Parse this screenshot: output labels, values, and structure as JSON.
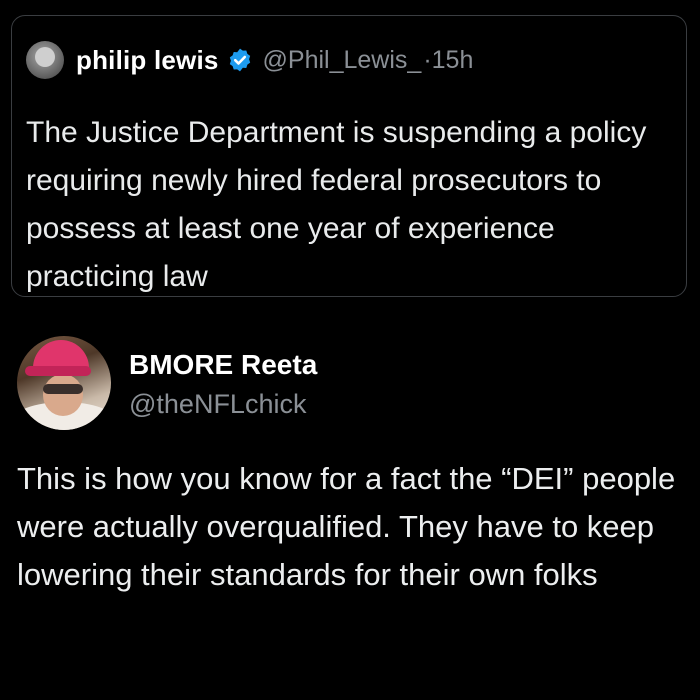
{
  "quoted_tweet": {
    "author_name": "philip lewis",
    "handle": "@Phil_Lewis_",
    "time": "·15h",
    "text": "The Justice Department is suspending a policy requiring newly hired federal prosecutors to possess at least one year of experience practicing law",
    "verified_icon": "verified-badge-icon",
    "verified_color": "#1d9bf0"
  },
  "reply_tweet": {
    "author_name": "BMORE Reeta",
    "handle": "@theNFLchick",
    "text": "This is how you know for a fact the “DEI” people were actually overqualified. They have to keep lowering their standards for their own folks"
  },
  "colors": {
    "background": "#000000",
    "primary_text": "#e7e9ea",
    "secondary_text": "#8b9096",
    "border": "#3a3d41"
  }
}
